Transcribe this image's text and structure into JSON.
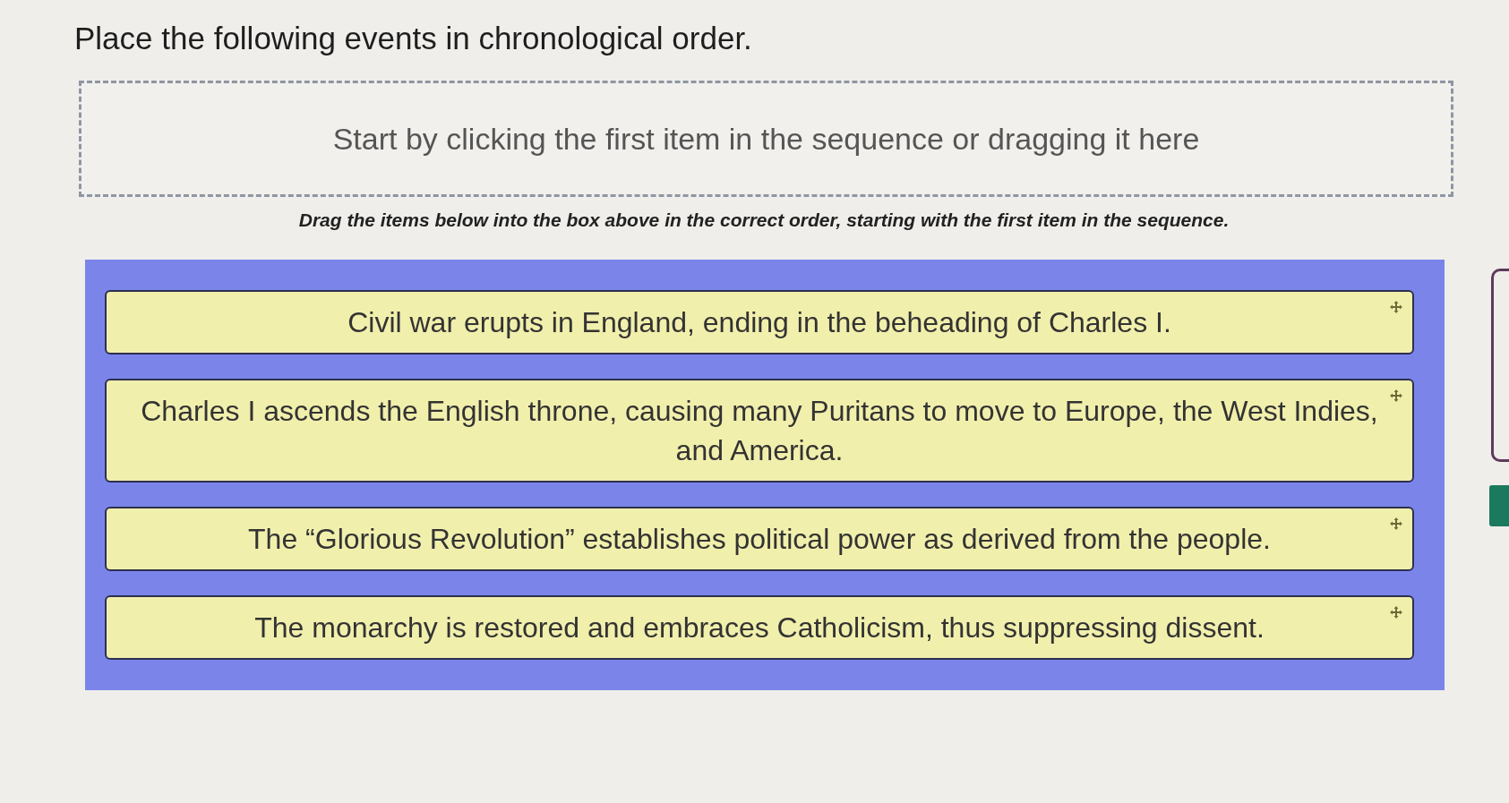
{
  "prompt": "Place the following events in chronological order.",
  "drop_zone": {
    "placeholder": "Start by clicking the first item in the sequence or dragging it here"
  },
  "instruction": "Drag the items below into the box above in the correct order, starting with the first item in the sequence.",
  "items": [
    {
      "text": "Civil war erupts in England, ending in the beheading of Charles I."
    },
    {
      "text": "Charles I ascends the English throne, causing many Puritans to move to Europe, the West Indies, and America."
    },
    {
      "text": "The “Glorious Revolution” establishes political power as derived from the people."
    },
    {
      "text": "The monarchy is restored and embraces Catholicism, thus suppressing dissent."
    }
  ]
}
